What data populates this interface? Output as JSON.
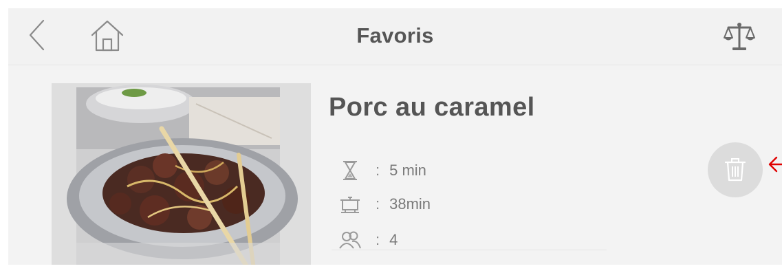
{
  "header": {
    "title": "Favoris",
    "back_icon": "chevron-left-icon",
    "home_icon": "home-icon",
    "scale_icon": "balance-scale-icon"
  },
  "recipe": {
    "name": "Porc au caramel",
    "prep_time": "5 min",
    "cook_time": "38min",
    "servings": "4",
    "separator": ":",
    "prep_icon": "hourglass-icon",
    "cook_icon": "cooking-pot-icon",
    "servings_icon": "people-icon",
    "delete_icon": "trash-icon"
  },
  "colors": {
    "header_bg": "#f2f2f2",
    "text_primary": "#555555",
    "text_secondary": "#7a7a7a",
    "delete_button_bg": "#dcdcdc",
    "annotation_arrow": "#e00000"
  }
}
